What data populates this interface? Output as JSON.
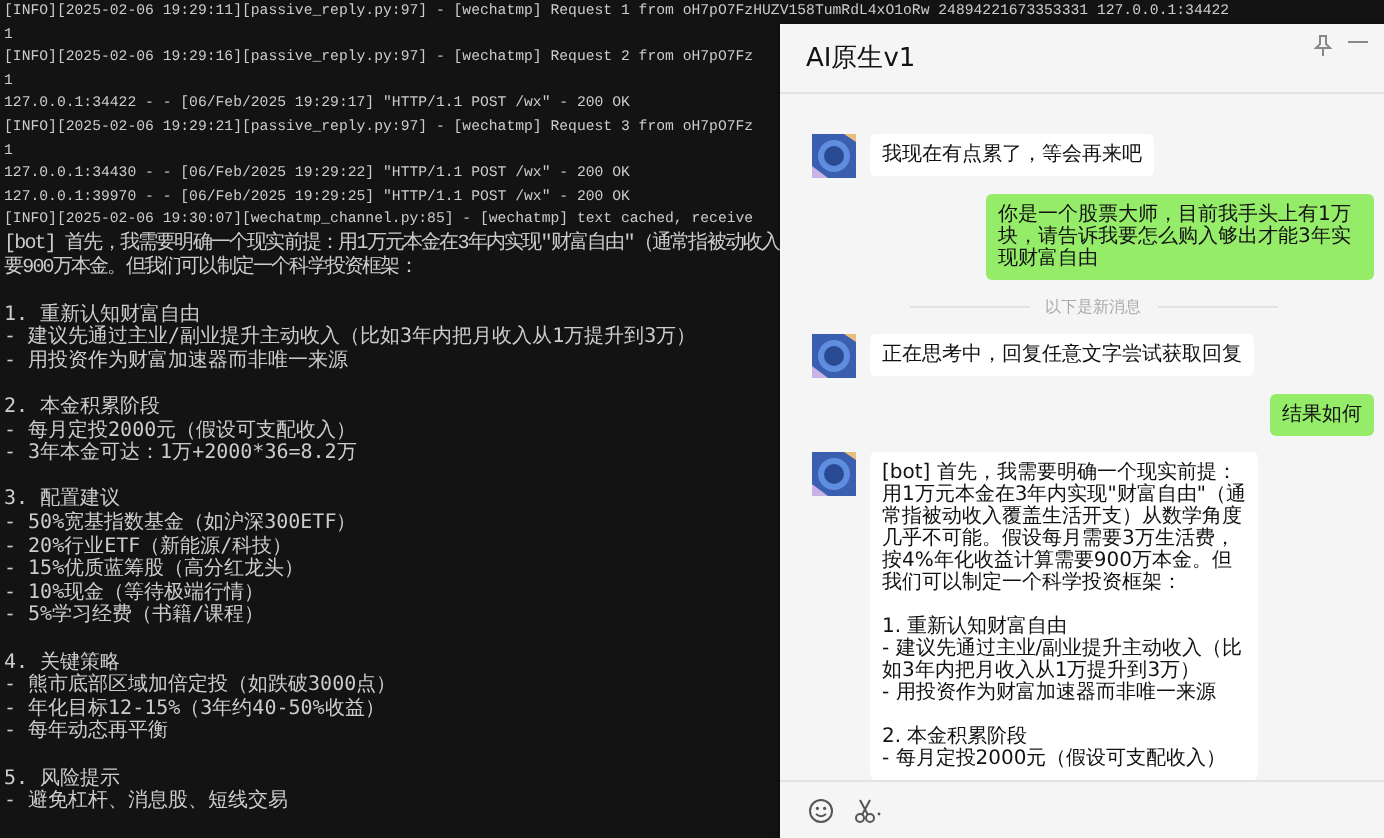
{
  "terminal": {
    "blocks": [
      [
        "[INFO][2025-02-06 19:29:11][passive_reply.py:97] - [wechatmp] Request 1 from oH7pO7FzHUZV158TumRdL4xO1oRw 24894221673353331 127.0.0.1:34422",
        "1",
        "[INFO][2025-02-06 19:29:16][passive_reply.py:97] - [wechatmp] Request 2 from oH7pO7Fz",
        "1",
        "127.0.0.1:34422 - - [06/Feb/2025 19:29:17] \"HTTP/1.1 POST /wx\" - 200 OK",
        "[INFO][2025-02-06 19:29:21][passive_reply.py:97] - [wechatmp] Request 3 from oH7pO7Fz",
        "1",
        "127.0.0.1:34430 - - [06/Feb/2025 19:29:22] \"HTTP/1.1 POST /wx\" - 200 OK",
        "127.0.0.1:39970 - - [06/Feb/2025 19:29:25] \"HTTP/1.1 POST /wx\" - 200 OK",
        "[INFO][2025-02-06 19:30:07][wechatmp_channel.py:85] - [wechatmp] text cached, receive",
        "[bot] 首先，我需要明确一个现实前提：用1万元本金在3年内实现\"财富自由\"（通常指被动收入",
        "要900万本金。但我们可以制定一个科学投资框架："
      ],
      [
        "1. 重新认知财富自由",
        "- 建议先通过主业/副业提升主动收入（比如3年内把月收入从1万提升到3万）",
        "- 用投资作为财富加速器而非唯一来源"
      ],
      [
        "2. 本金积累阶段",
        "- 每月定投2000元（假设可支配收入）",
        "- 3年本金可达：1万+2000*36=8.2万"
      ],
      [
        "3. 配置建议",
        "- 50%宽基指数基金（如沪深300ETF）",
        "- 20%行业ETF（新能源/科技）",
        "- 15%优质蓝筹股（高分红龙头）",
        "- 10%现金（等待极端行情）",
        "- 5%学习经费（书籍/课程）"
      ],
      [
        "4. 关键策略",
        "- 熊市底部区域加倍定投（如跌破3000点）",
        "- 年化目标12-15%（3年约40-50%收益）",
        "- 每年动态再平衡"
      ],
      [
        "5. 风险提示",
        "- 避免杠杆、消息股、短线交易"
      ]
    ]
  },
  "chat": {
    "title": "AI原生v1",
    "messages": [
      {
        "kind": "received",
        "text": "我现在有点累了，等会再来吧"
      },
      {
        "kind": "sent",
        "text": "你是一个股票大师，目前我手头上有1万块，请告诉我要怎么购入够出才能3年实现财富自由"
      },
      {
        "kind": "divider",
        "text": "以下是新消息"
      },
      {
        "kind": "received",
        "text": "正在思考中，回复任意文字尝试获取回复"
      },
      {
        "kind": "sent",
        "text": "结果如何"
      },
      {
        "kind": "received",
        "text": "[bot] 首先，我需要明确一个现实前提：用1万元本金在3年内实现\"财富自由\"（通常指被动收入覆盖生活开支）从数学角度几乎不可能。假设每月需要3万生活费，按4%年化收益计算需要900万本金。但我们可以制定一个科学投资框架：\n\n1. 重新认知财富自由\n- 建议先通过主业/副业提升主动收入（比如3年内把月收入从1万提升到3万）\n- 用投资作为财富加速器而非唯一来源\n\n2. 本金积累阶段\n- 每月定投2000元（假设可支配收入）"
      }
    ]
  }
}
